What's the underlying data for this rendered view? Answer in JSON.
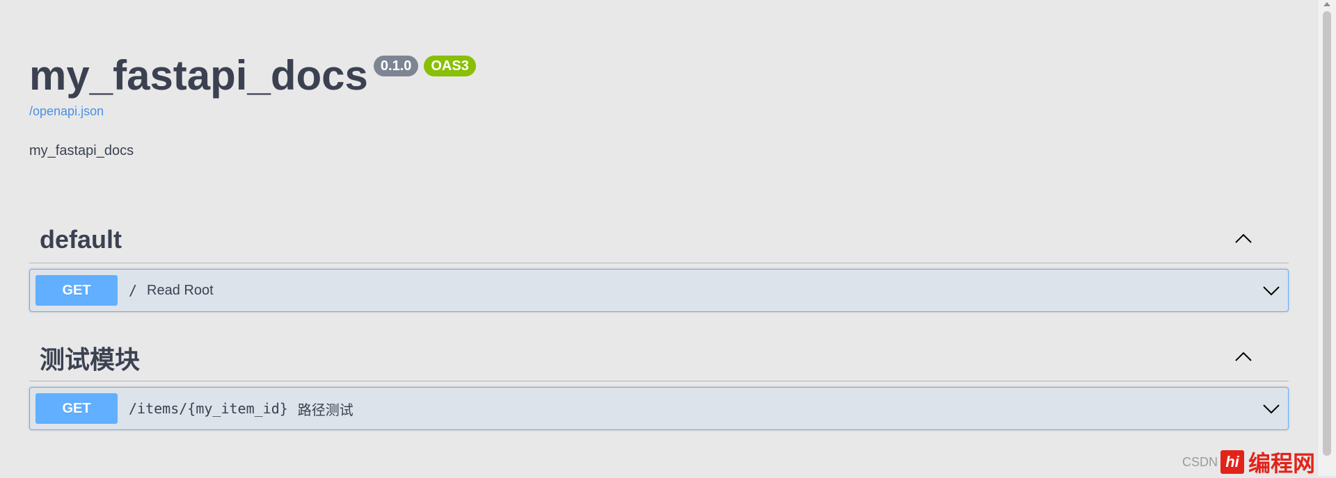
{
  "info": {
    "title": "my_fastapi_docs",
    "version": "0.1.0",
    "oas_badge": "OAS3",
    "spec_link": "/openapi.json",
    "description": "my_fastapi_docs"
  },
  "tags": [
    {
      "name": "default",
      "operations": [
        {
          "method": "GET",
          "path": "/",
          "summary": "Read Root"
        }
      ]
    },
    {
      "name": "测试模块",
      "operations": [
        {
          "method": "GET",
          "path": "/items/{my_item_id}",
          "summary": "路径测试"
        }
      ]
    }
  ],
  "watermark": {
    "source": "CSDN",
    "logo": "hi",
    "site": "编程网"
  },
  "colors": {
    "get": "#61affe",
    "oas": "#89bf04",
    "version": "#7d8492",
    "link": "#4990e2",
    "text": "#3b4151"
  }
}
